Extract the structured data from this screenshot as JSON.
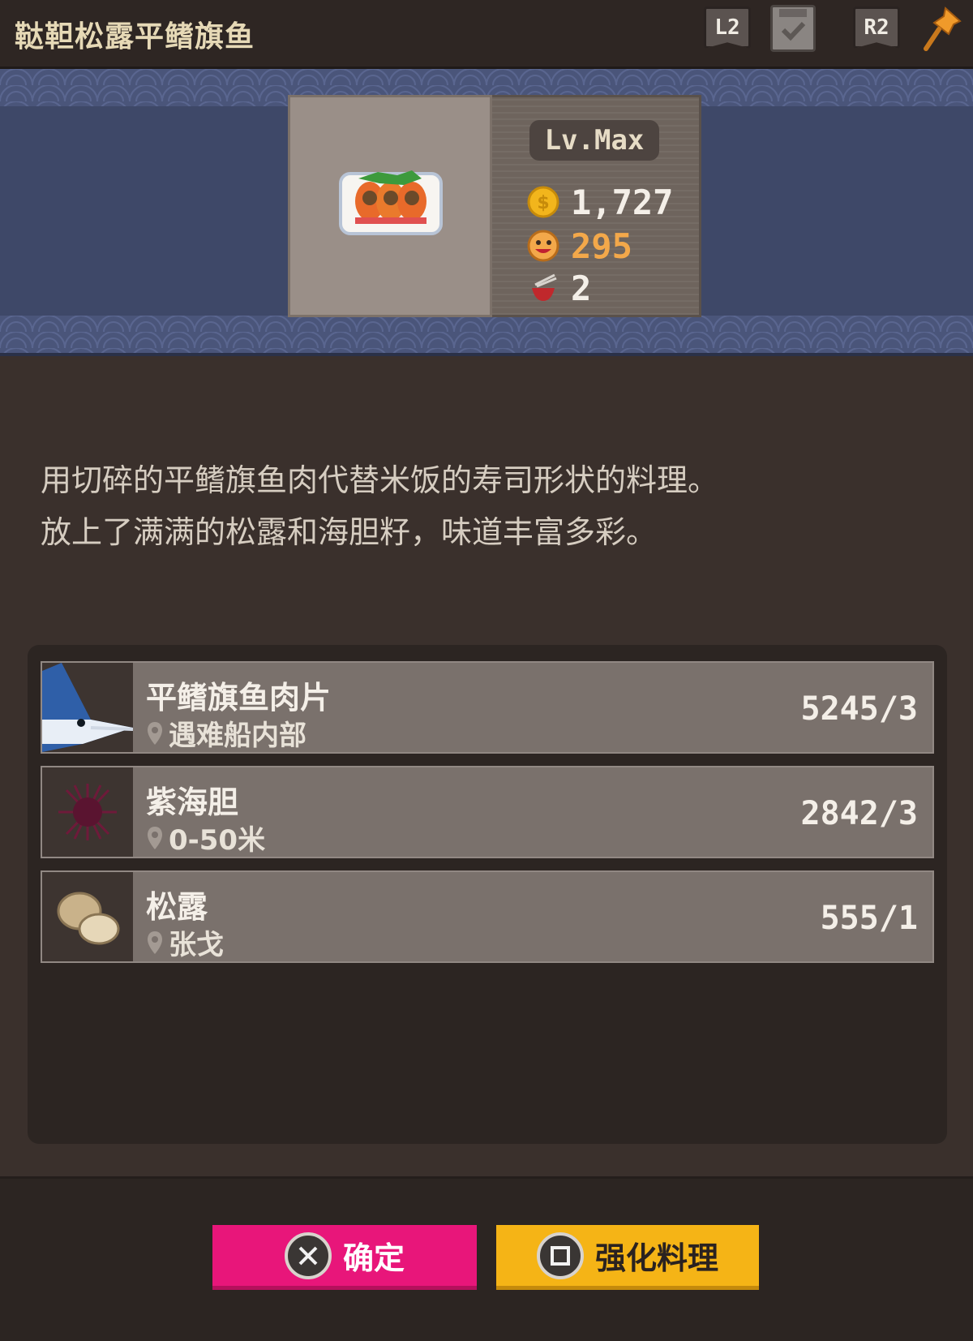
{
  "header": {
    "title": "鞑靼松露平鳍旗鱼",
    "l2_label": "L2",
    "r2_label": "R2"
  },
  "dish": {
    "level": "Lv.Max",
    "price": "1,727",
    "taste": "295",
    "servings": "2"
  },
  "description": {
    "line1": "用切碎的平鳍旗鱼肉代替米饭的寿司形状的料理。",
    "line2": "放上了满满的松露和海胆籽，味道丰富多彩。"
  },
  "ingredients": [
    {
      "name": "平鳍旗鱼肉片",
      "location": "遇难船内部",
      "count": "5245/3"
    },
    {
      "name": "紫海胆",
      "location": "0-50米",
      "count": "2842/3"
    },
    {
      "name": "松露",
      "location": "张戈",
      "count": "555/1"
    }
  ],
  "buttons": {
    "confirm": "确定",
    "enhance": "强化料理"
  },
  "colors": {
    "confirm_bg": "#e8167a",
    "enhance_bg": "#f5b416",
    "price_color": "#f4efe8",
    "taste_color": "#f3a84a"
  }
}
